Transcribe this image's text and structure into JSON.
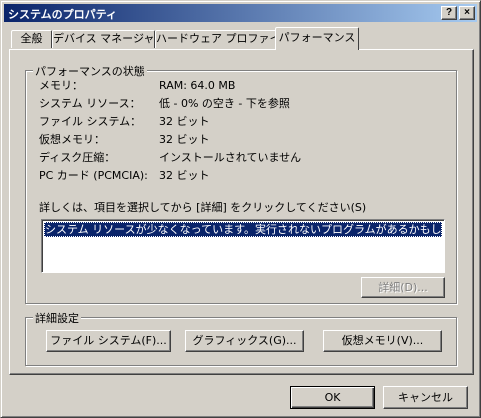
{
  "window": {
    "title": "システムのプロパティ",
    "help_glyph": "?",
    "close_glyph": "×"
  },
  "tabs": [
    {
      "label": "全般",
      "active": false
    },
    {
      "label": "デバイス マネージャ",
      "active": false
    },
    {
      "label": "ハードウェア プロファイル",
      "active": false
    },
    {
      "label": "パフォーマンス",
      "active": true
    }
  ],
  "performance": {
    "title": "パフォーマンスの状態",
    "rows": [
      {
        "label": "メモリ：",
        "value": "RAM: 64.0 MB"
      },
      {
        "label": "システム リソース：",
        "value": "低 - 0% の空き - 下を参照"
      },
      {
        "label": "ファイル システム：",
        "value": "32 ビット"
      },
      {
        "label": "仮想メモリ：",
        "value": "32 ビット"
      },
      {
        "label": "ディスク圧縮：",
        "value": "インストールされていません"
      },
      {
        "label": "PC カード (PCMCIA):",
        "value": "32 ビット"
      }
    ],
    "details_prompt": "詳しくは、項目を選択してから [詳細] をクリックしてください(S)",
    "list_items": [
      "システム リソースが少なくなっています。実行されないプログラムがあるかもしれません。"
    ],
    "details_button": "詳細(D)..."
  },
  "advanced": {
    "title": "詳細設定",
    "buttons": [
      "ファイル システム(F)...",
      "グラフィックス(G)...",
      "仮想メモリ(V)..."
    ]
  },
  "footer": {
    "ok": "OK",
    "cancel": "キャンセル"
  },
  "colors": {
    "face": "#d4d0c8",
    "title_start": "#0a246a",
    "title_end": "#a6caf0",
    "selection": "#0a246a"
  }
}
